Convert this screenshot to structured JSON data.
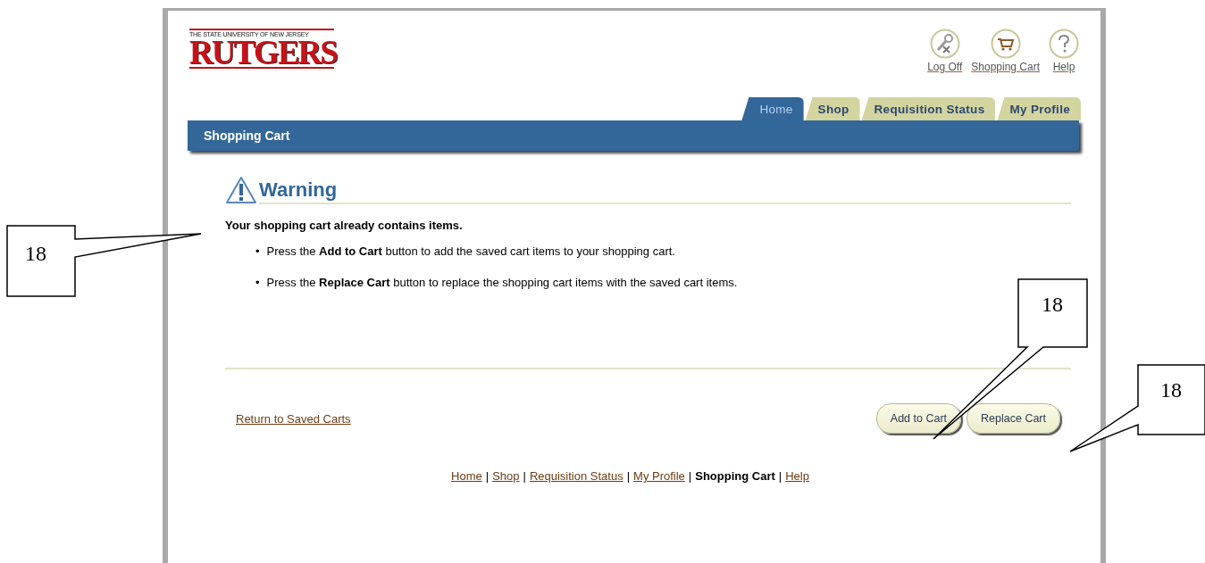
{
  "logo": {
    "subtitle": "THE STATE UNIVERSITY OF NEW JERSEY",
    "name": "RUTGERS"
  },
  "global_links": [
    {
      "label": "Log Off",
      "kind": "logoff"
    },
    {
      "label": "Shopping Cart",
      "kind": "cart"
    },
    {
      "label": "Help",
      "kind": "help"
    }
  ],
  "tabs": [
    {
      "label": "Home",
      "selected": true
    },
    {
      "label": "Shop",
      "selected": false
    },
    {
      "label": "Requisition Status",
      "selected": false
    },
    {
      "label": "My Profile",
      "selected": false
    }
  ],
  "page_title": "Shopping Cart",
  "warning": {
    "heading": "Warning",
    "message": "Your shopping cart already contains items.",
    "bullet_marker": "•",
    "bullets": [
      "Press the **Add to Cart** button to add the saved cart items to your shopping cart.",
      "Press the **Replace Cart** button to replace the shopping cart items with the saved cart items."
    ]
  },
  "return_link": "Return to Saved Carts",
  "buttons": [
    "Add to Cart",
    "Replace Cart"
  ],
  "footer": {
    "separator": "|",
    "items": [
      {
        "label": "Home",
        "selected": false
      },
      {
        "label": "Shop",
        "selected": false
      },
      {
        "label": "Requisition Status",
        "selected": false
      },
      {
        "label": "My Profile",
        "selected": false
      },
      {
        "label": "Shopping Cart",
        "selected": true
      },
      {
        "label": "Help",
        "selected": false
      }
    ]
  },
  "callouts": [
    {
      "label": "18"
    },
    {
      "label": "18"
    },
    {
      "label": "18"
    }
  ]
}
